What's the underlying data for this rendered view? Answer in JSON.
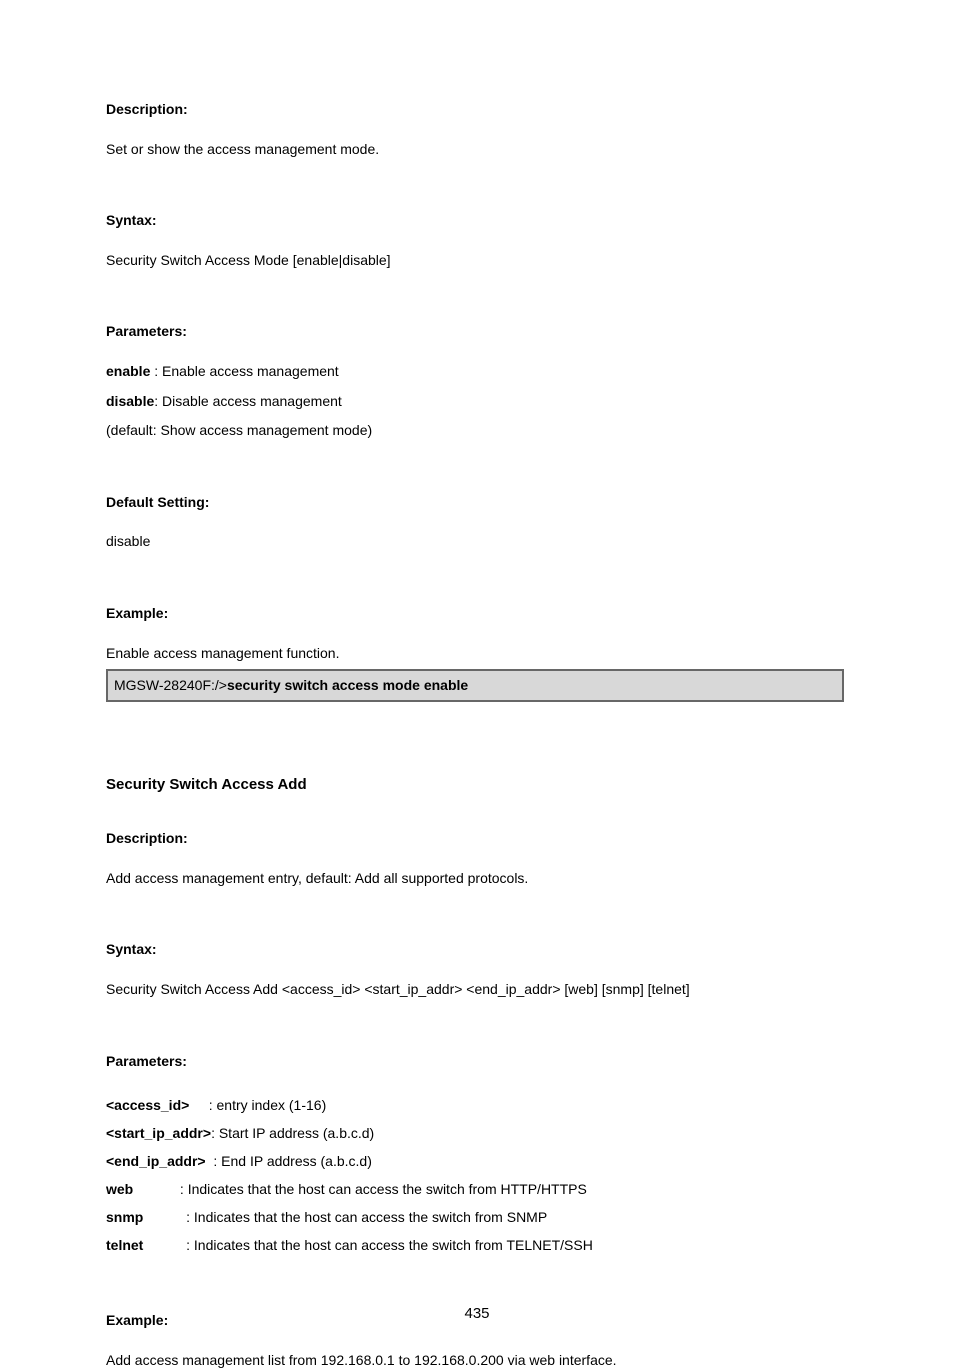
{
  "section1": {
    "desc_label": "Description:",
    "desc_text": "Set or show the access management mode.",
    "syntax_label": "Syntax:",
    "syntax_text": "Security Switch Access Mode [enable|disable]",
    "params_label": "Parameters:",
    "param_enable_key": "enable",
    "param_enable_text": " : Enable access management",
    "param_disable_key": "disable",
    "param_disable_text": ": Disable access management",
    "param_default": "(default: Show access management mode)",
    "default_label": "Default Setting:",
    "default_value": "disable",
    "example_label": "Example:",
    "example_text": "Enable access management function.",
    "terminal_prompt": "MGSW-28240F:/>",
    "terminal_cmd": "security switch access mode enable"
  },
  "section2": {
    "heading": "Security Switch Access Add",
    "desc_label": "Description:",
    "desc_text": "Add access management entry, default: Add all supported protocols.",
    "syntax_label": "Syntax:",
    "syntax_text": "Security Switch Access Add <access_id> <start_ip_addr> <end_ip_addr> [web] [snmp] [telnet]",
    "params_label": "Parameters:",
    "p1_key": "<access_id>",
    "p1_text": "     : entry index (1-16)",
    "p2_key": "<start_ip_addr>",
    "p2_text": ": Start IP address (a.b.c.d)",
    "p3_key": "<end_ip_addr>",
    "p3_text": "  : End IP address (a.b.c.d)",
    "p4_key": "web",
    "p4_text": "            : Indicates that the host can access the switch from HTTP/HTTPS",
    "p5_key": "snmp",
    "p5_text": "           : Indicates that the host can access the switch from SNMP",
    "p6_key": "telnet",
    "p6_text": "           : Indicates that the host can access the switch from TELNET/SSH",
    "example_label": "Example:",
    "example_text": "Add access management list from 192.168.0.1 to 192.168.0.200 via web interface."
  },
  "page_number": "435"
}
